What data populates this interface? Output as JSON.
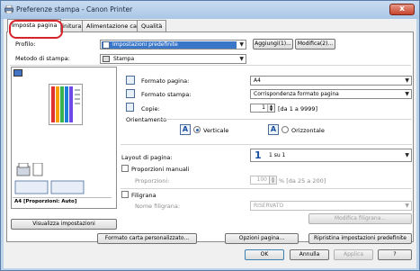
{
  "window": {
    "title": "Preferenze stampa - Canon Printer",
    "close_glyph": "x"
  },
  "tabs": [
    {
      "label": "Imposta pagina",
      "active": true
    },
    {
      "label": "Finitura",
      "active": false
    },
    {
      "label": "Alimentazione carta",
      "active": false
    },
    {
      "label": "Qualità",
      "active": false
    }
  ],
  "profile": {
    "label": "Profilo:",
    "value": "Impostazioni predefinite",
    "add_button": "Aggiungi(1)...",
    "edit_button": "Modifica(2)..."
  },
  "output_method": {
    "label": "Metodo di stampa:",
    "value": "Stampa"
  },
  "preview": {
    "caption": "A4 [Proporzioni: Auto]"
  },
  "page_size": {
    "label": "Formato pagina:",
    "value": "A4"
  },
  "output_size": {
    "label": "Formato stampa:",
    "value": "Corrispondenza formato pagina"
  },
  "copies": {
    "label": "Copie:",
    "value": "1",
    "range": "[da 1 a 9999]"
  },
  "orientation": {
    "label": "Orientamento",
    "portrait": "Verticale",
    "landscape": "Orizzontale",
    "selected": "portrait"
  },
  "layout": {
    "label": "Layout di pagina:",
    "value": "1 su 1",
    "icon_text": "1"
  },
  "manual_scaling": {
    "label": "Proporzioni manuali",
    "checked": false,
    "scaling_label": "Proporzioni:",
    "scaling_value": "100",
    "scaling_range": "% [da 25 a 200]"
  },
  "watermark": {
    "label": "Filigrana",
    "checked": false,
    "name_label": "Nome filigrana:",
    "name_value": "RISERVATO",
    "edit_button": "Modifica filigrana..."
  },
  "view_settings_button": "Visualizza impostazioni",
  "bottom_panel_buttons": {
    "custom_paper": "Formato carta personalizzato...",
    "page_options": "Opzioni pagina...",
    "restore_defaults": "Ripristina impostazioni predefinite"
  },
  "dialog_buttons": {
    "ok": "OK",
    "cancel": "Annulla",
    "apply": "Applica",
    "help": "?"
  },
  "colors": {
    "accent": "#3b77c8",
    "highlight_ring": "#d8232a",
    "title_bar": "#bcd3ea"
  }
}
